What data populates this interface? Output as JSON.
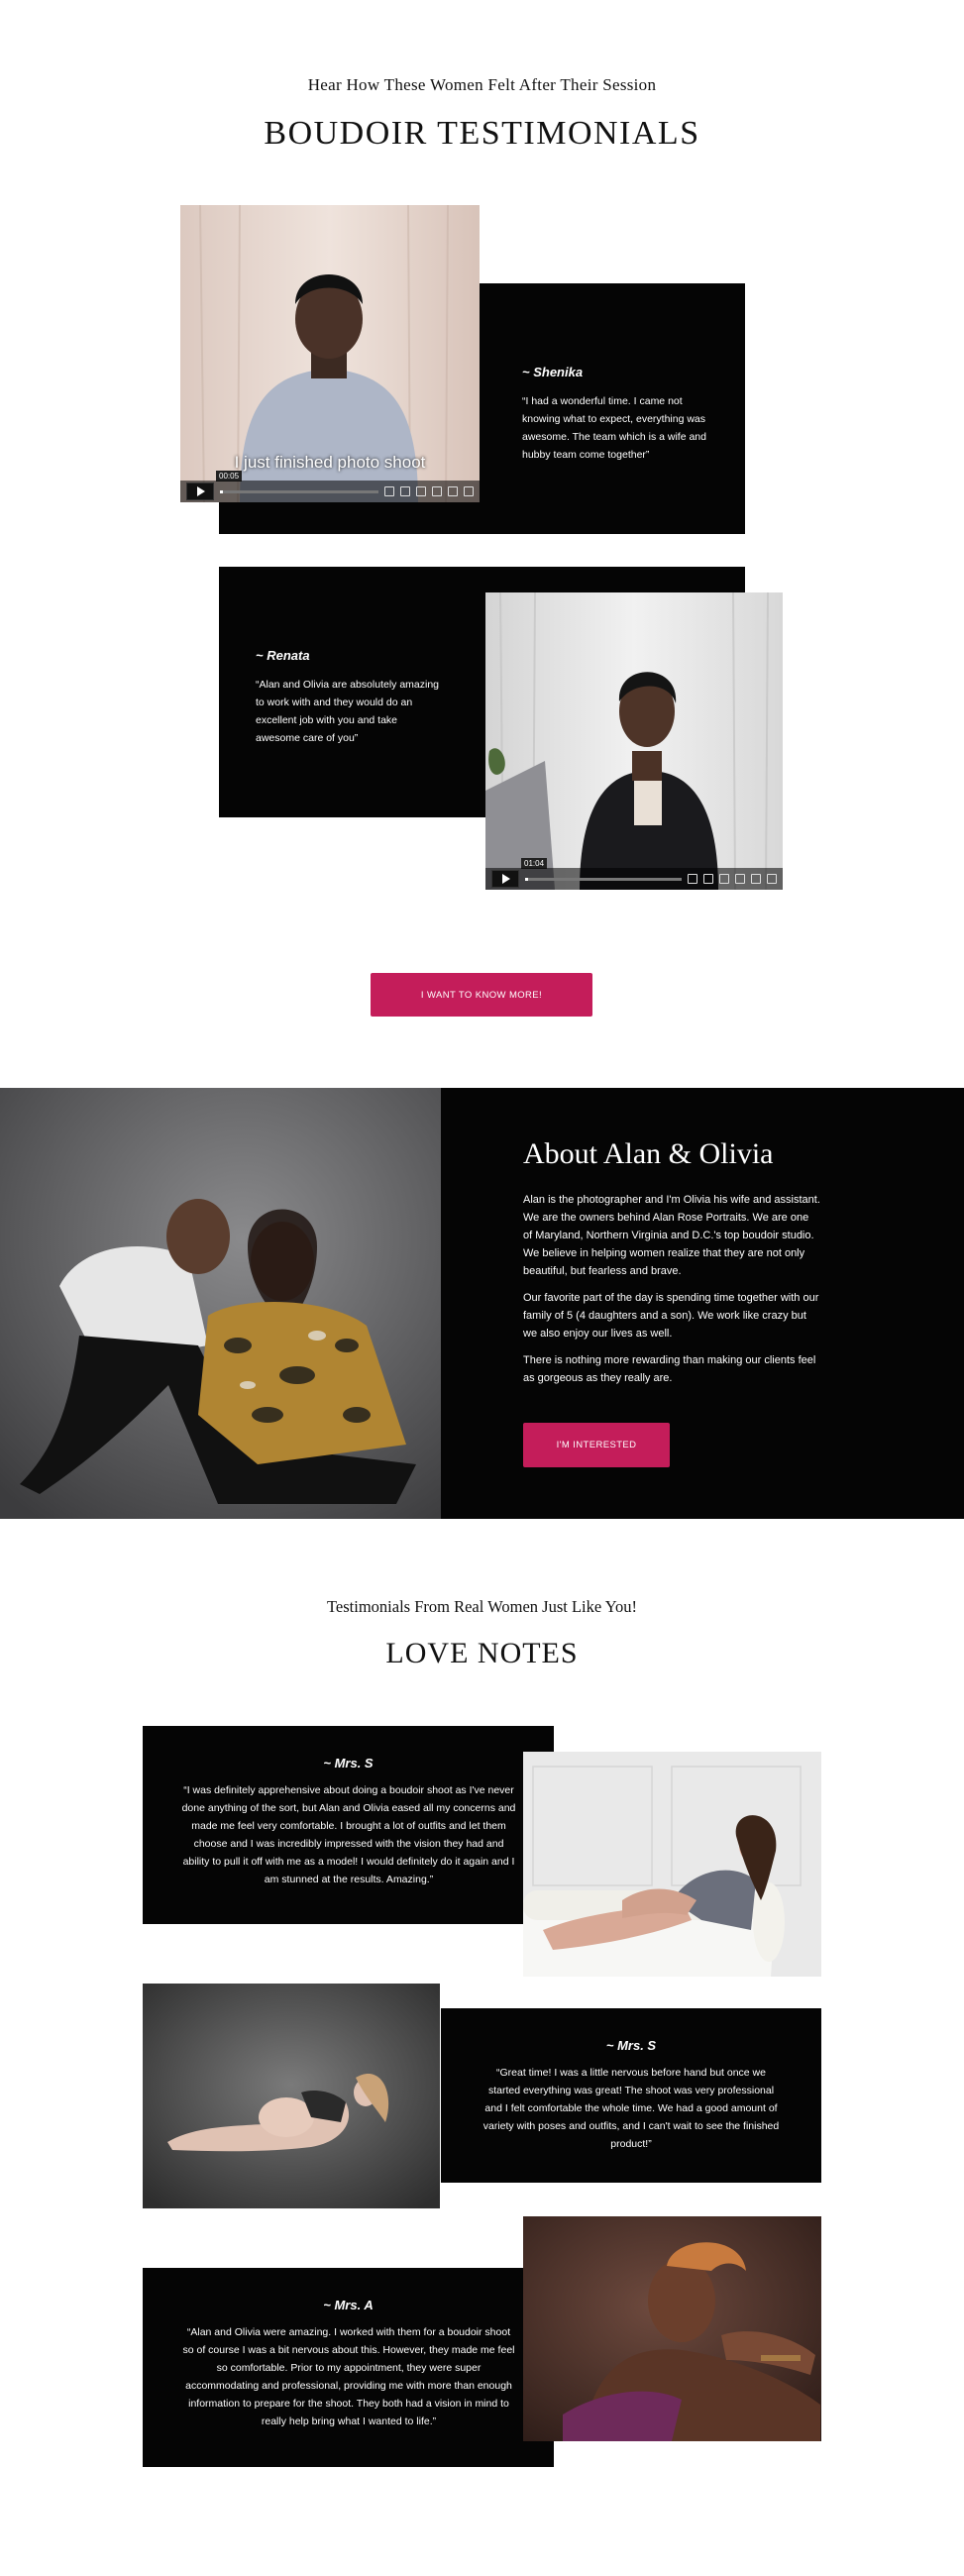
{
  "testimonials_section": {
    "subtitle": "Hear How These Women Felt After Their Session",
    "title": "BOUDOIR TESTIMONIALS",
    "videos": [
      {
        "name": "~ Shenika",
        "quote": "“I had a wonderful time. I came not knowing what to expect, everything was awesome. The team which is a wife and hubby team come together”",
        "caption": "I just finished photo shoot",
        "time": "00:05"
      },
      {
        "name": "~ Renata",
        "quote": "“Alan and Olivia are absolutely amazing to work with and they would do an excellent job with you and take awesome care of you”",
        "time": "01:04"
      }
    ],
    "cta": "I WANT TO KNOW MORE!"
  },
  "about": {
    "title": "About Alan & Olivia",
    "paragraphs": [
      "Alan is the photographer and I'm Olivia his wife and assistant. We are the owners behind Alan Rose Portraits. We are one of Maryland, Northern Virginia and D.C.'s top boudoir studio. We believe in helping women realize that they are not only beautiful, but fearless and brave.",
      "Our favorite part of the day is spending time together with our family of 5 (4 daughters and a son). We work like crazy but we also enjoy our lives as well.",
      "There is nothing more rewarding than making our clients feel as gorgeous as they really are."
    ],
    "cta": "I'M INTERESTED"
  },
  "love_notes": {
    "subtitle": "Testimonials From Real Women Just Like You!",
    "title": "LOVE NOTES",
    "notes": [
      {
        "name": "~ Mrs. S",
        "quote": "“I was definitely apprehensive about doing a boudoir shoot as I've never done anything of the sort, but Alan and Olivia eased all my concerns and made me feel very comfortable. I brought a lot of outfits and let them choose and I was incredibly impressed with the vision they had and ability to pull it off with me as a model! I would definitely do it again and I am stunned at the results. Amazing.”"
      },
      {
        "name": "~ Mrs. S",
        "quote": "“Great time! I was a little nervous before hand but once we started everything was great! The shoot was very professional and I felt comfortable the whole time. We had a good amount of variety with poses and outfits, and I can't wait to see the finished product!”"
      },
      {
        "name": "~ Mrs. A",
        "quote": "“Alan and Olivia were amazing. I worked with them for a boudoir shoot so of course I was a bit nervous about this. However, they made me feel so comfortable. Prior to my appointment, they were super accommodating and professional, providing me with more than enough information to prepare for the shoot. They both had a vision in mind to really help bring what I wanted to life.”"
      }
    ]
  },
  "colors": {
    "accent": "#c41d5a",
    "card": "#050505"
  }
}
